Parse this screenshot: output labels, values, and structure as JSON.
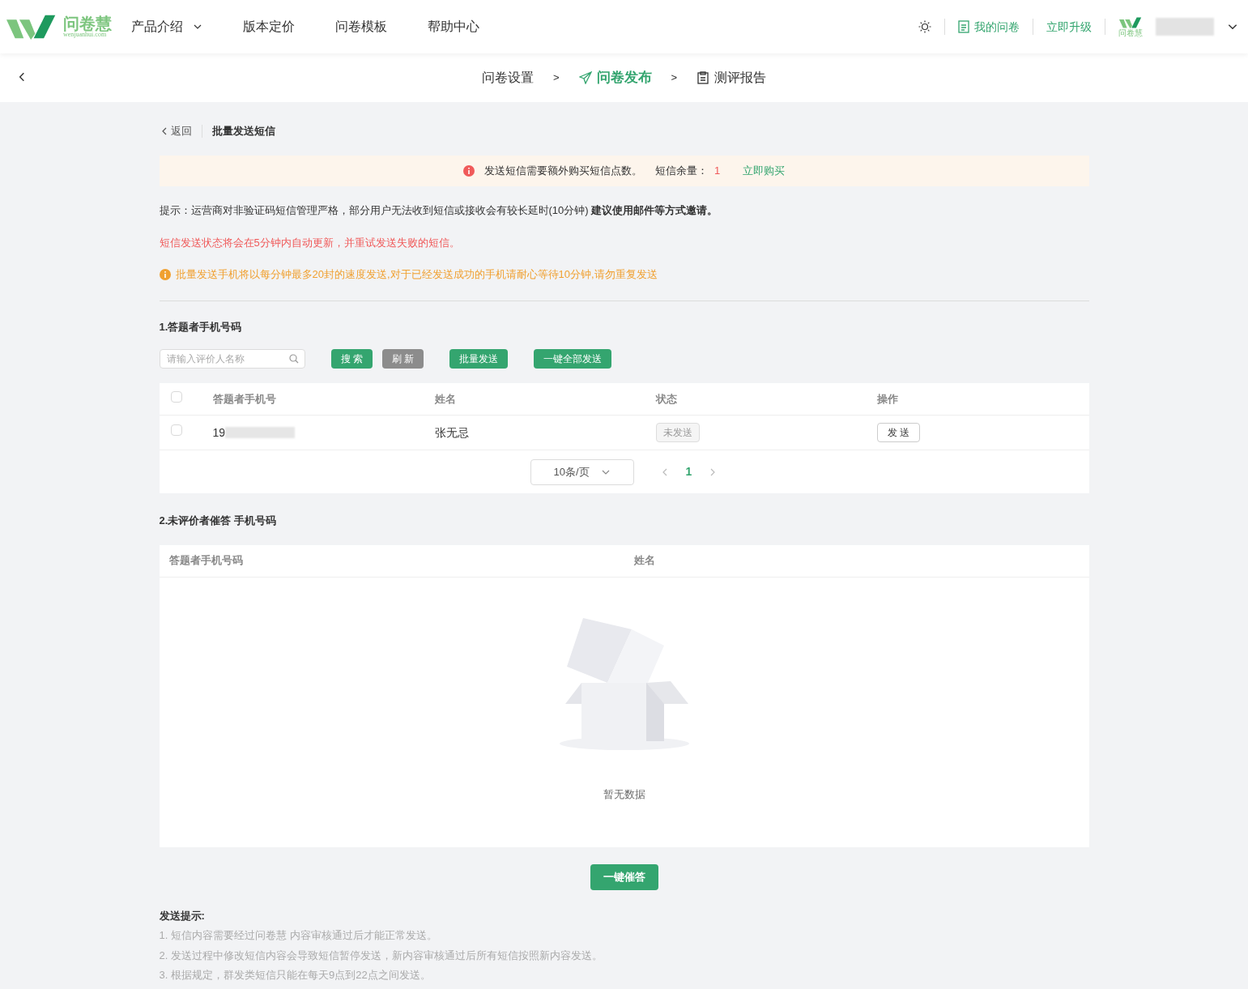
{
  "header": {
    "logo": {
      "name": "问卷慧",
      "domain": "wenjuanhui.com"
    },
    "nav": [
      {
        "label": "产品介绍",
        "dropdown": true
      },
      {
        "label": "版本定价",
        "dropdown": false
      },
      {
        "label": "问卷模板",
        "dropdown": false
      },
      {
        "label": "帮助中心",
        "dropdown": false
      }
    ],
    "my_surveys": "我的问卷",
    "upgrade": "立即升级",
    "account_logo_caption": "问卷慧"
  },
  "steps": [
    {
      "label": "问卷设置",
      "selected": false,
      "kind": "plain"
    },
    {
      "label": "问卷发布",
      "selected": true,
      "kind": "publish"
    },
    {
      "label": "测评报告",
      "selected": false,
      "kind": "report"
    }
  ],
  "step_separator": ">",
  "breadcrumb": {
    "back": "返回",
    "title": "批量发送短信"
  },
  "notice": {
    "text": "发送短信需要额外购买短信点数。",
    "balance_label": "短信余量：",
    "balance": "1",
    "buy_link": "立即购买"
  },
  "tip": "提示：运营商对非验证码短信管理严格，部分用户无法收到短信或接收会有较长延时(10分钟) **建议使用邮件等方式邀请。**",
  "auto_update_note": "短信发送状态将会在5分钟内自动更新，并重试发送失败的短信。",
  "rate_warning": "批量发送手机将以每分钟最多20封的速度发送,对于已经发送成功的手机请耐心等待10分钟,请勿重复发送",
  "section1": {
    "title": "1.答题者手机号码",
    "search": {
      "placeholder": "请输入评价人名称"
    },
    "buttons": [
      {
        "label": "搜 索",
        "kind": "primary"
      },
      {
        "label": "刷 新",
        "kind": "gray"
      },
      {
        "label": "批量发送",
        "kind": "primary"
      },
      {
        "label": "一键全部发送",
        "kind": "primary"
      }
    ],
    "table": {
      "columns": [
        "答题者手机号",
        "姓名",
        "状态",
        "操作"
      ],
      "all_checked": false,
      "rows": [
        {
          "checked": false,
          "phone": "19",
          "name": "张无忌",
          "status": "未发送",
          "action": "发 送"
        }
      ]
    },
    "pagination": {
      "page_size": "10条/页",
      "pages": [
        {
          "label": "1",
          "selected": true
        }
      ]
    }
  },
  "section2": {
    "title": "2.未评价者催答 手机号码",
    "columns": [
      "答题者手机号码",
      "姓名"
    ],
    "empty_text": "暂无数据",
    "button": "一键催答"
  },
  "send_tips": {
    "title": "发送提示:",
    "items": [
      "1. 短信内容需要经过问卷慧 内容审核通过后才能正常发送。",
      "2. 发送过程中修改短信内容会导致短信暂停发送，新内容审核通过后所有短信按照新内容发送。",
      "3. 根据规定，群发类短信只能在每天9点到22点之间发送。"
    ]
  }
}
